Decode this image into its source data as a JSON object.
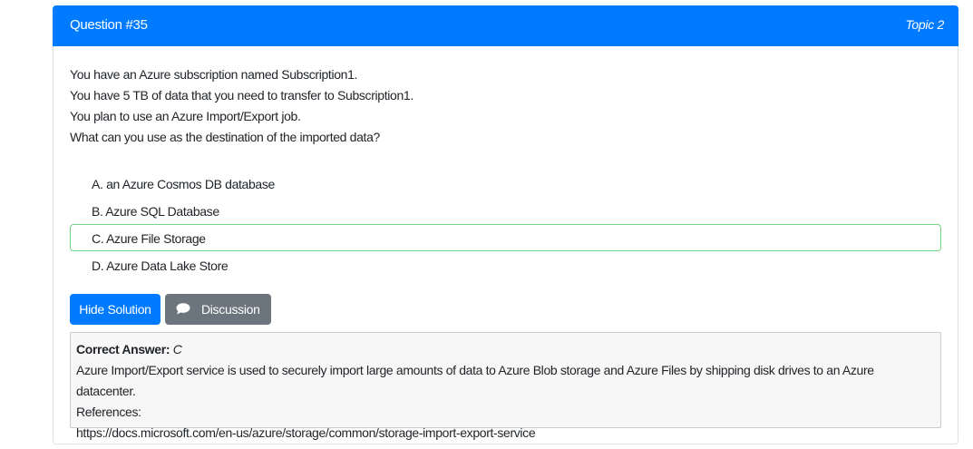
{
  "header": {
    "question_label": "Question #35",
    "topic_label": "Topic 2",
    "bg_color": "#007bff"
  },
  "question": {
    "lines": [
      "You have an Azure subscription named Subscription1.",
      "You have 5 TB of data that you need to transfer to Subscription1.",
      "You plan to use an Azure Import/Export job.",
      "What can you use as the destination of the imported data?"
    ]
  },
  "choices": [
    {
      "text": "A. an Azure Cosmos DB database",
      "correct": false
    },
    {
      "text": "B. Azure SQL Database",
      "correct": false
    },
    {
      "text": "C. Azure File Storage",
      "correct": true
    },
    {
      "text": "D. Azure Data Lake Store",
      "correct": false
    }
  ],
  "buttons": {
    "solution_label": "Hide Solution",
    "discussion_label": "Discussion",
    "discussion_icon": "speech-bubble-icon"
  },
  "answer": {
    "label": "Correct Answer:",
    "value": "C",
    "explanation": "Azure Import/Export service is used to securely import large amounts of data to Azure Blob storage and Azure Files by shipping disk drives to an Azure datacenter.",
    "references_label": "References:",
    "reference_url": "https://docs.microsoft.com/en-us/azure/storage/common/storage-import-export-service"
  },
  "colors": {
    "primary": "#007bff",
    "secondary": "#6c757d",
    "correct_border": "#74d58a"
  }
}
